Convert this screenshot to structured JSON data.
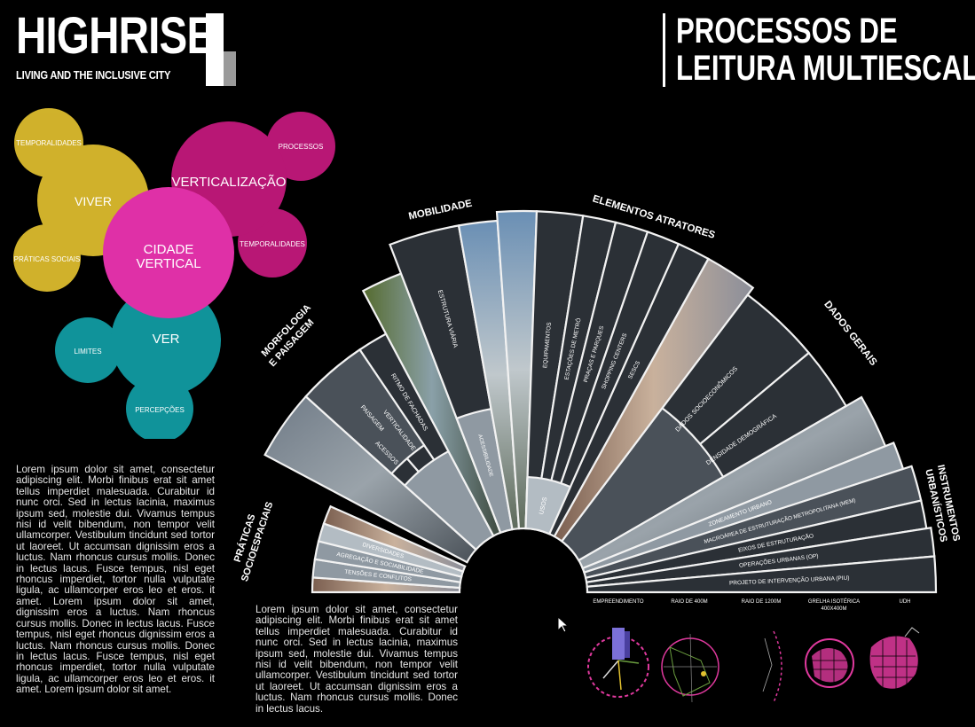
{
  "brand": {
    "title": "HIGHRISE",
    "subtitle": "LIVING AND THE INCLUSIVE CITY"
  },
  "poster_title": {
    "line1": "PROCESSOS DE",
    "line2": "LEITURA MULTIESCALAR"
  },
  "bubbles": {
    "viver": "VIVER",
    "temporalidades_yellow": "TEMPORALIDADES",
    "praticas_sociais": "PRÁTICAS SOCIAIS",
    "verticalizacao": "VERTICALIZAÇÃO",
    "processos": "PROCESSOS",
    "temporalidades_magenta": "TEMPORALIDADES",
    "cidade": "CIDADE",
    "vertical": "VERTICAL",
    "ver": "VER",
    "limites": "LIMITES",
    "percepcoes": "PERCEPÇÕES",
    "colors": {
      "yellow": "#e2c12f",
      "magenta": "#c8197f",
      "pink": "#f235b6",
      "teal": "#12a0a8"
    }
  },
  "category_labels": {
    "praticas": [
      "PRÁTICAS",
      "SOCIOESPACIAIS"
    ],
    "morfologia": [
      "MORFOLOGIA",
      "E PAISAGEM"
    ],
    "mobilidade": "MOBILIDADE",
    "elementos": "ELEMENTOS ATRATORES",
    "dados": "DADOS GERAIS",
    "instrumentos": [
      "INSTRUMENTOS",
      "URBANÍSTICOS"
    ]
  },
  "fan_labels": {
    "paisagem": "PAISAGEM",
    "acessos": "ACESSOS",
    "verticalidade": "VERTICALIDADE",
    "ritmo": "RITMO DE FACHADAS",
    "estrutura_viaria": "ESTRUTURA VIÁRIA",
    "acessibilidade": "ACESSIBILIDADE",
    "equipamentos": "EQUIPAMENTOS",
    "estacoes": "ESTAÇÕES DE METRÔ",
    "pracas": "PRAÇAS E PARQUES",
    "shopping": "SHOPPING CENTERS",
    "sescs": "SESCS",
    "usos": "USOS",
    "dados_socio": "DADOS SOCIOECONÔMICOS",
    "densidade": "DENSIDADE DEMOGRÁFICA",
    "diversidades": "DIVERSIDADES",
    "agregacao": "AGREGAÇÃO E SOCIABILIDADE",
    "tensoes": "TENSÕES E CONFLITOS",
    "zoneamento": "ZONEAMENTO URBANO",
    "macroarea": "MACROÁREA DE ESTRUTURAÇÃO METROPOLITANA (MEM)",
    "eixos": "EIXOS DE ESTRUTURAÇÃO",
    "operacoes": "OPERAÇÕES URBANAS (OP)",
    "projeto": "PROJETO DE INTERVENÇÃO URBANA (PIU)"
  },
  "scale_labels": {
    "empreendimento": "EMPREENDIMENTO",
    "raio400": "RAIO DE 400M",
    "raio1200": "RAIO DE 1200M",
    "grelha1": "GRELHA ISOTÉRICA",
    "grelha2": "400X400M",
    "udh": "UDH"
  },
  "text_left": "Lorem ipsum dolor sit amet, consectetur adipiscing elit. Morbi finibus erat sit amet tellus imperdiet malesuada. Curabitur id nunc orci. Sed in lectus lacinia, maximus ipsum sed, molestie dui. Vivamus tempus nisi id velit bibendum, non tempor velit ullamcorper. Vestibulum tincidunt sed tortor ut laoreet. Ut accumsan dignissim eros a luctus. Nam rhoncus cursus mollis. Donec in lectus lacus. Fusce tempus, nisl eget rhoncus imperdiet, tortor nulla vulputate ligula, ac ullamcorper eros leo et eros. it amet. Lorem ipsum dolor sit amet, dignissim eros a luctus. Nam rhoncus cursus mollis. Donec in lectus lacus. Fusce tempus, nisl eget rhoncus dignissim eros a luctus. Nam rhoncus cursus mollis. Donec in lectus lacus. Fusce tempus, nisl eget rhoncus imperdiet, tortor nulla vulputate ligula, ac ullamcorper eros leo et eros. it amet. Lorem ipsum dolor sit amet.",
  "text_bottom": "Lorem ipsum dolor sit amet, consectetur adipiscing elit. Morbi finibus erat sit amet tellus imperdiet malesuada. Curabitur id nunc orci. Sed in lectus lacinia, maximus ipsum sed, molestie dui. Vivamus tempus nisi id velit bibendum, non tempor velit ullamcorper. Vestibulum tincidunt sed tortor ut laoreet. Ut accumsan dignissim eros a luctus. Nam rhoncus cursus mollis. Donec in lectus lacus.",
  "icons": {
    "cursor": "mouse-pointer-icon"
  }
}
